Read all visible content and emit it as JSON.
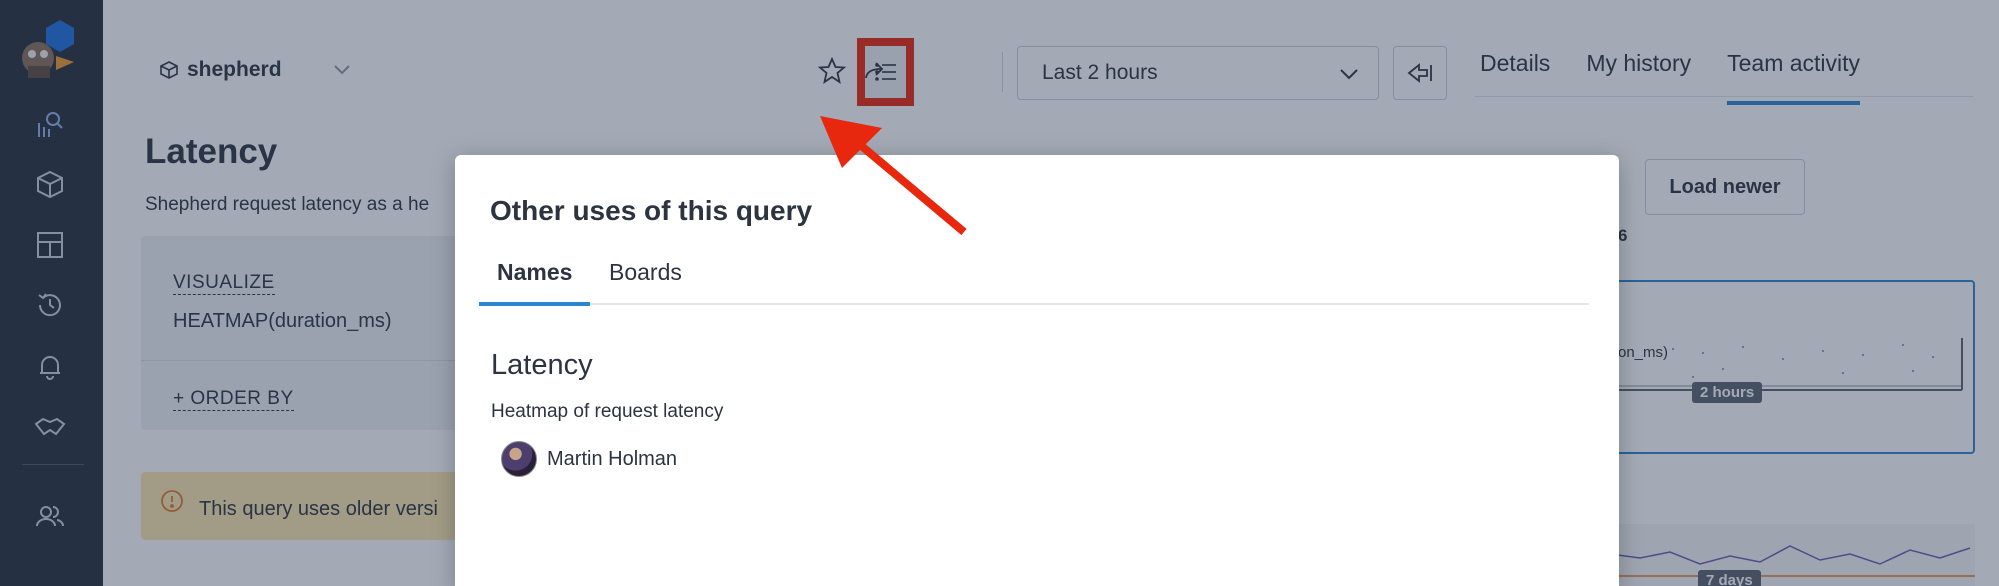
{
  "dataset": {
    "name": "shepherd"
  },
  "toolbar": {
    "time_range": "Last 2 hours"
  },
  "page": {
    "title": "Latency",
    "description": "Shepherd request latency as a he"
  },
  "builder": {
    "visualize_label": "VISUALIZE",
    "visualize_value": "HEATMAP(duration_ms)",
    "order_by_label": "+ ORDER BY"
  },
  "warning": {
    "text": "This query uses older versi"
  },
  "right_panel": {
    "tabs": [
      "Details",
      "My history",
      "Team activity"
    ],
    "active_tab": "Team activity",
    "load_newer": "Load newer",
    "partial_number": "6",
    "card_text": "on_ms)",
    "card_badge": "2 hours",
    "card2_badge": "7 days"
  },
  "modal": {
    "title": "Other uses of this query",
    "tabs": [
      "Names",
      "Boards"
    ],
    "active_tab": "Names",
    "result": {
      "name": "Latency",
      "description": "Heatmap of request latency",
      "user": "Martin Holman"
    }
  },
  "colors": {
    "sidebar": "#252f3c",
    "accent": "#2a86d3",
    "highlight": "#e8270f",
    "warning_bg": "#fbe7ae"
  }
}
